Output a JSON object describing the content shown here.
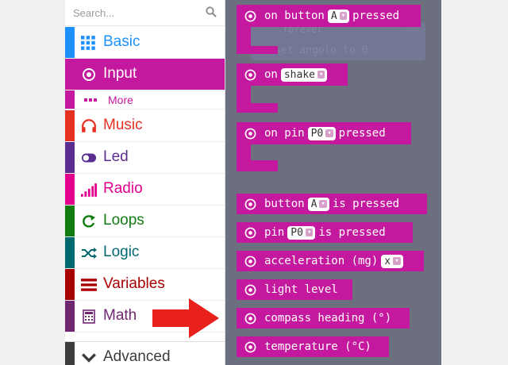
{
  "search": {
    "placeholder": "Search..."
  },
  "categories": [
    {
      "label": "Basic",
      "icon": "grid-icon",
      "color": "#1e90ff"
    },
    {
      "label": "Input",
      "icon": "input-target-icon",
      "color": "#c4199e",
      "selected": true
    },
    {
      "label": "Music",
      "icon": "headphones-icon",
      "color": "#e63022"
    },
    {
      "label": "Led",
      "icon": "toggle-icon",
      "color": "#5c2d91"
    },
    {
      "label": "Radio",
      "icon": "signal-bars-icon",
      "color": "#e3008c"
    },
    {
      "label": "Loops",
      "icon": "refresh-icon",
      "color": "#107c10"
    },
    {
      "label": "Logic",
      "icon": "shuffle-icon",
      "color": "#006970"
    },
    {
      "label": "Variables",
      "icon": "list-lines-icon",
      "color": "#a80000"
    },
    {
      "label": "Math",
      "icon": "calculator-icon",
      "color": "#712672"
    },
    {
      "label": "Advanced",
      "icon": "chevron-down-icon",
      "color": "#3c3c3c"
    }
  ],
  "more": {
    "label": "More"
  },
  "ghost": {
    "row1": "forever",
    "row2_a": "set",
    "row2_b": "angolo",
    "row2_c": "to",
    "row2_d": "0"
  },
  "blocks": {
    "on_button": {
      "pre": "on button",
      "dd": "A",
      "post": "pressed"
    },
    "on_shake": {
      "pre": "on",
      "dd": "shake"
    },
    "on_pin": {
      "pre": "on pin",
      "dd": "P0",
      "post": "pressed"
    },
    "button_is_pressed": {
      "pre": "button",
      "dd": "A",
      "post": "is pressed"
    },
    "pin_is_pressed": {
      "pre": "pin",
      "dd": "P0",
      "post": "is pressed"
    },
    "acceleration": {
      "pre": "acceleration (mg)",
      "dd": "x"
    },
    "light_level": {
      "pre": "light level"
    },
    "compass_heading": {
      "pre": "compass heading (°)"
    },
    "temperature": {
      "pre": "temperature (°C)"
    }
  },
  "colors": {
    "input": "#c4199e",
    "workspace": "#6b6f7e",
    "arrow": "#e8211c"
  }
}
